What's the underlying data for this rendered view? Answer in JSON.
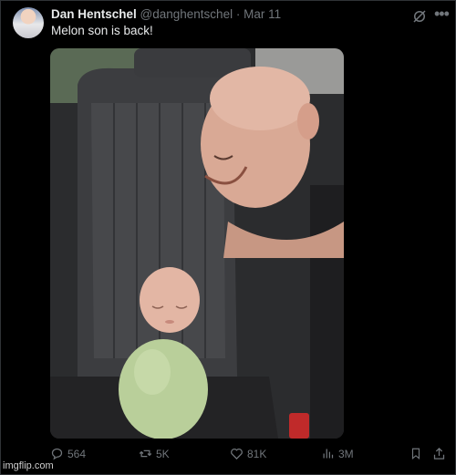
{
  "post": {
    "author_name": "Dan Hentschel",
    "author_handle": "@danghentschel",
    "separator": "·",
    "date": "Mar 11",
    "text": "Melon son is back!"
  },
  "actions": {
    "replies": "564",
    "reposts": "5K",
    "likes": "81K",
    "views": "3M"
  },
  "watermark": "imgflip.com",
  "icons": [
    "grok-icon",
    "more-icon",
    "reply-icon",
    "repost-icon",
    "like-icon",
    "views-icon",
    "bookmark-icon",
    "share-icon"
  ],
  "colors": {
    "background": "#000000",
    "text": "#e7e9ea",
    "muted": "#71767b"
  }
}
